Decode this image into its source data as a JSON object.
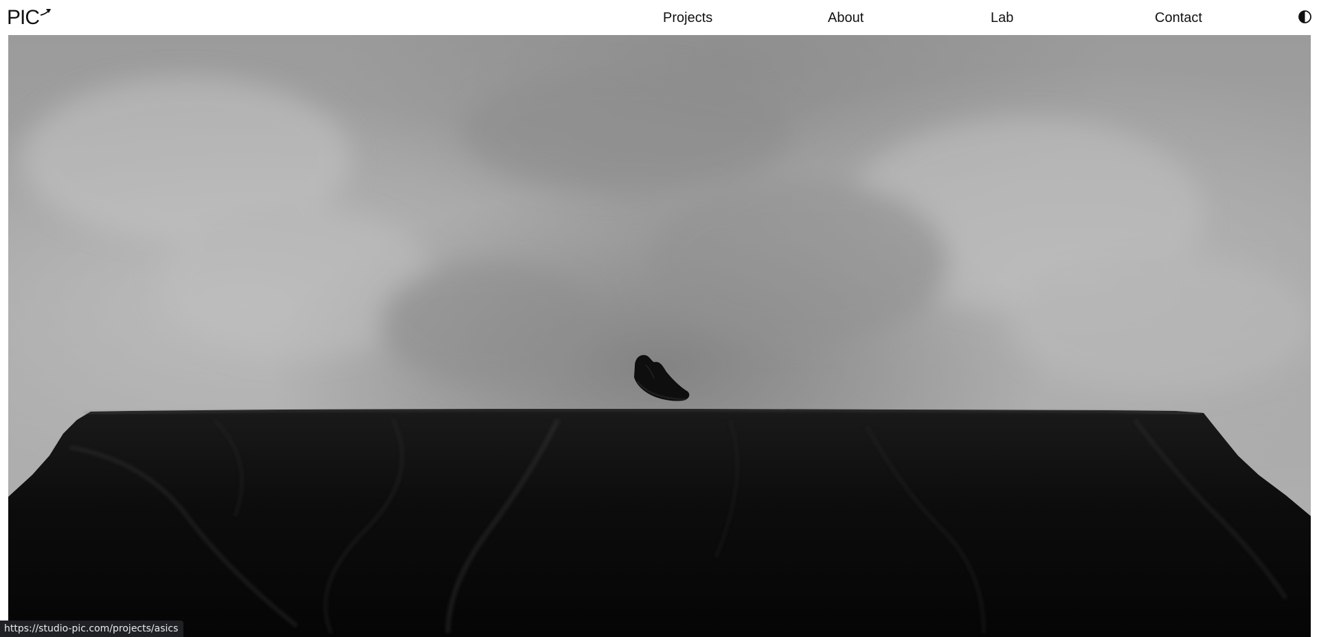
{
  "header": {
    "logo_text": "PIC",
    "logo_icon": "arrow-swoosh-icon",
    "nav": {
      "projects": "Projects",
      "about": "About",
      "lab": "Lab",
      "contact": "Contact"
    },
    "theme_toggle_icon": "contrast-half-circle-icon"
  },
  "hero": {
    "scene": "grayscale cloudy sky over dark rocky plateau with floating shoe",
    "subject_icon": "shoe-silhouette"
  },
  "status_bar": {
    "url": "https://studio-pic.com/projects/asics"
  },
  "colors": {
    "page_background": "#ffffff",
    "text": "#111111",
    "status_bar_bg": "#202124",
    "status_bar_text": "#e8eaed"
  }
}
